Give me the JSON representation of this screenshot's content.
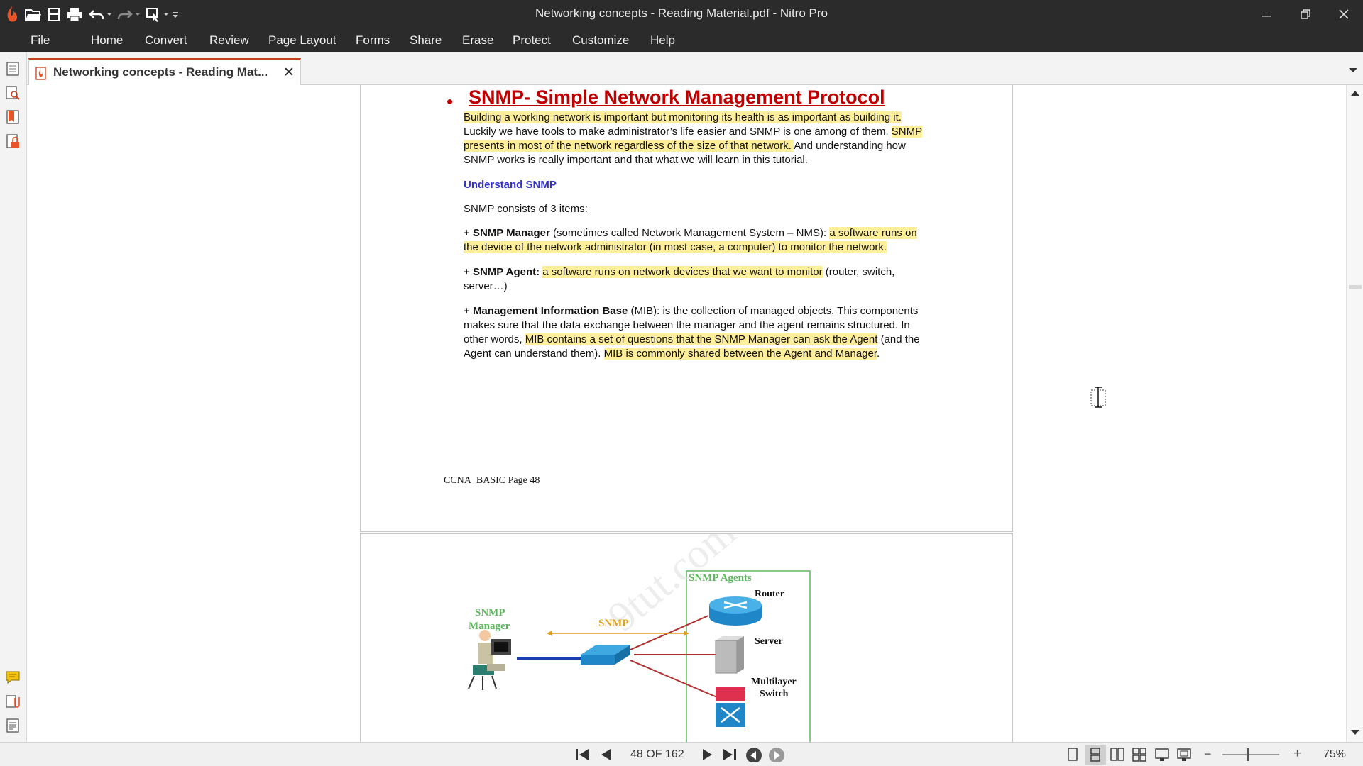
{
  "window": {
    "title": "Networking concepts - Reading Material.pdf - Nitro Pro"
  },
  "menu": {
    "items": [
      "File",
      "Home",
      "Convert",
      "Review",
      "Page Layout",
      "Forms",
      "Share",
      "Erase",
      "Protect",
      "Customize",
      "Help"
    ]
  },
  "tab": {
    "label": "Networking concepts - Reading Mat...",
    "close": "✕"
  },
  "document": {
    "heading_bullet": "•",
    "heading": "SNMP- Simple Network Management  Protocol",
    "para1": {
      "l1": "Building a working network is important but monitoring its health is as important as building it.",
      "l2a": "Luckily we have tools to make administrator’s life easier and SNMP is one among of them. ",
      "l2b": "SNMP",
      "l3a": "presents in most of the network regardless of the size of that network. ",
      "l3b": "And understanding how",
      "l4": "SNMP works is really important and that what we will learn in this tutorial."
    },
    "subheading": "Understand SNMP",
    "consists": "SNMP consists of 3 items:",
    "manager": {
      "plus": "+ ",
      "bold": "SNMP Manager",
      "rest": " (sometimes called Network Management System – NMS): ",
      "hl1": "a software runs on",
      "hl2": "the device of the network administrator (in most case, a computer) to monitor the network."
    },
    "agent": {
      "plus": "+ ",
      "bold": "SNMP Agent:",
      "sp": " ",
      "hl": "a software runs on network devices that we want to monitor",
      "rest": " (router, switch,",
      "l2": "server…)"
    },
    "mib": {
      "plus": "+ ",
      "bold": "Management Information Base",
      "rest": " (MIB): is the collection of managed objects. This components",
      "l2": "makes sure that the data exchange between the manager and the agent remains structured. In",
      "l3a": "other words, ",
      "l3b": "MIB contains a set of questions that the SNMP Manager can ask the Agent",
      "l3c": " (and the",
      "l4a": "Agent can understand them). ",
      "l4b": "MIB is commonly shared between the Agent and Manager",
      "l4c": "."
    },
    "footer": "CCNA_BASIC Page 48",
    "diagram": {
      "agents_title": "SNMP Agents",
      "router": "Router",
      "server": "Server",
      "multilayer1": "Multilayer",
      "multilayer2": "Switch",
      "manager1": "SNMP",
      "manager2": "Manager",
      "snmp": "SNMP",
      "watermark": "9tut.com"
    }
  },
  "status": {
    "page_indicator": "48 OF 162",
    "zoom": "75%",
    "zoom_minus": "−",
    "zoom_plus": "+"
  },
  "colors": {
    "accent": "#c8401f",
    "heading_red": "#c00000",
    "subheading_blue": "#3333cc",
    "highlight": "#ffef9a",
    "diagram_green": "#5fb85f",
    "diagram_yellow": "#e0a020"
  }
}
